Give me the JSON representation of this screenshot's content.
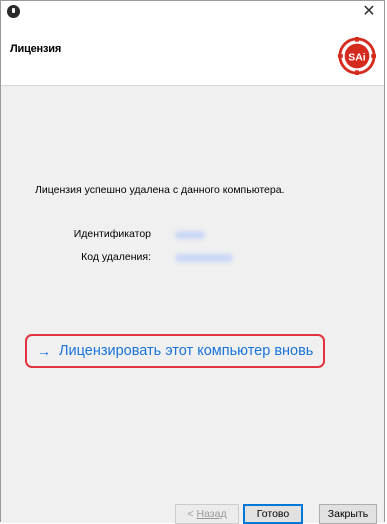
{
  "window": {
    "close_glyph": "✕",
    "app_icon": "info-icon"
  },
  "header": {
    "title": "Лицензия",
    "logo_text": "SAi"
  },
  "content": {
    "message": "Лицензия успешно удалена с данного компьютера.",
    "identifier_label": "Идентификатор",
    "removal_code_label": "Код удаления:",
    "relicense_arrow": "→",
    "relicense_label": "Лицензировать этот компьютер вновь"
  },
  "footer": {
    "back_prefix": "< ",
    "back_label": "Назад",
    "done_label": "Готово",
    "close_label": "Закрыть"
  },
  "colors": {
    "link": "#1a73d9",
    "highlight": "#e2343e",
    "logo": "#d52b1e",
    "accent": "#0078d7"
  }
}
